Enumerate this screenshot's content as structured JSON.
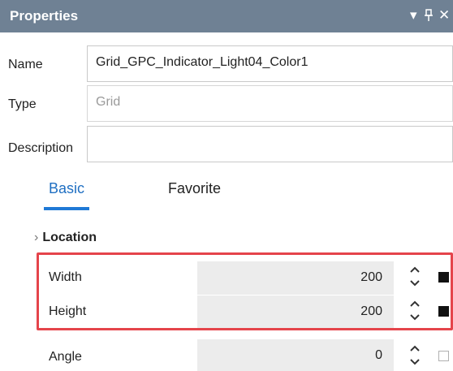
{
  "panel": {
    "title": "Properties",
    "controls": {
      "dropdown": "▾",
      "pin": "ᛘ",
      "close": "✕"
    }
  },
  "fields": {
    "name": {
      "label": "Name",
      "value": "Grid_GPC_Indicator_Light04_Color1"
    },
    "type": {
      "label": "Type",
      "value": "Grid"
    },
    "description": {
      "label": "Description",
      "value": ""
    }
  },
  "tabs": [
    {
      "label": "Basic",
      "active": true
    },
    {
      "label": "Favorite",
      "active": false
    }
  ],
  "group": {
    "chevron": "›",
    "label": "Location"
  },
  "properties": [
    {
      "label": "Width",
      "value": "200",
      "swatch": "filled"
    },
    {
      "label": "Height",
      "value": "200",
      "swatch": "filled"
    },
    {
      "label": "Angle",
      "value": "0",
      "swatch": "empty"
    }
  ],
  "colors": {
    "titlebar": "#6f8194",
    "accent": "#1f79d6",
    "highlight": "#e5444b"
  }
}
